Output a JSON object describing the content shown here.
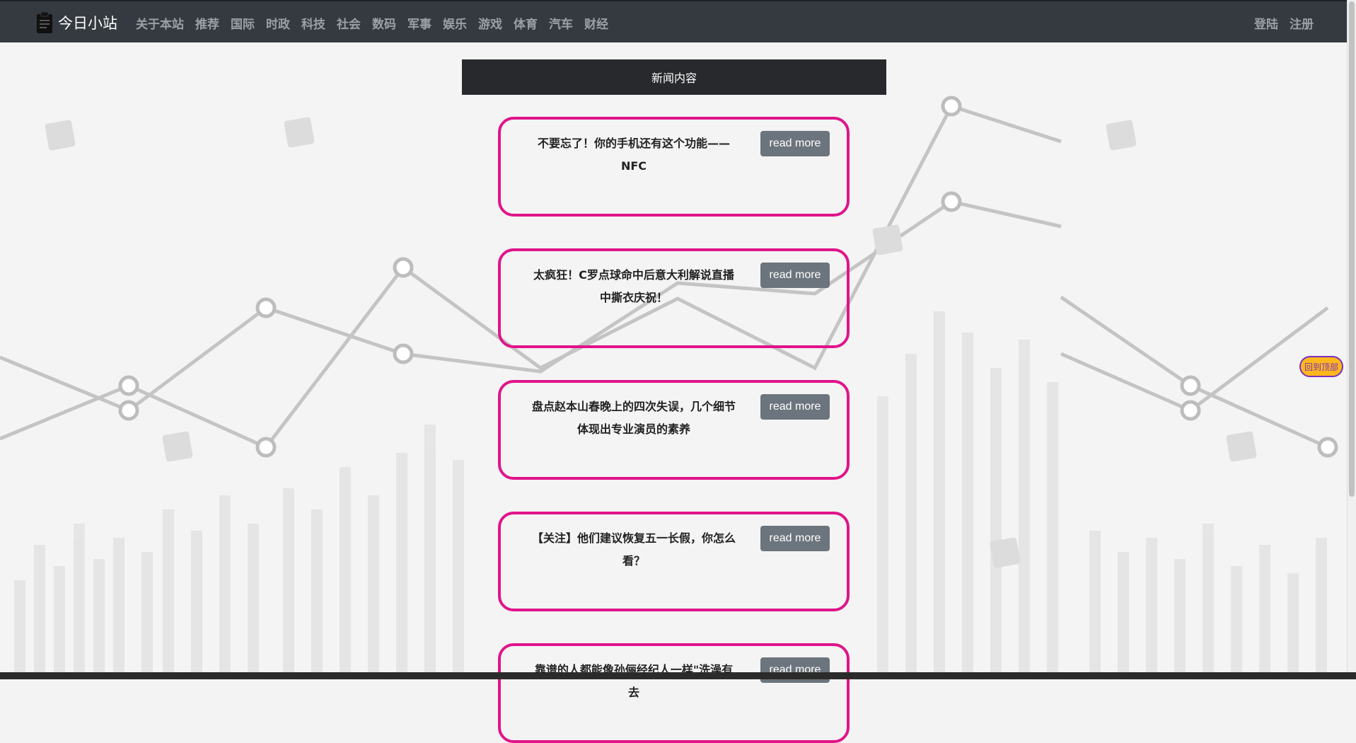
{
  "nav": {
    "brand": "今日小站",
    "links": [
      "关于本站",
      "推荐",
      "国际",
      "时政",
      "科技",
      "社会",
      "数码",
      "军事",
      "娱乐",
      "游戏",
      "体育",
      "汽车",
      "财经"
    ],
    "login": "登陆",
    "register": "注册"
  },
  "header": {
    "title": "新闻内容"
  },
  "news": [
    {
      "title": "不要忘了！你的手机还有这个功能——NFC",
      "button": "read more"
    },
    {
      "title": "太疯狂！C罗点球命中后意大利解说直播中撕衣庆祝！",
      "button": "read more"
    },
    {
      "title": "盘点赵本山春晚上的四次失误，几个细节体现出专业演员的素养",
      "button": "read more"
    },
    {
      "title": "【关注】他们建议恢复五一长假，你怎么看？",
      "button": "read more"
    },
    {
      "title": "靠谱的人都能像孙俪经纪人一样\"洗澡有去",
      "button": "read more"
    }
  ],
  "back_to_top": "回到顶部",
  "colors": {
    "navbar": "#343a40",
    "card_border": "#e0148a",
    "button": "#6c757d",
    "back_top_bg": "#ffb81c"
  }
}
